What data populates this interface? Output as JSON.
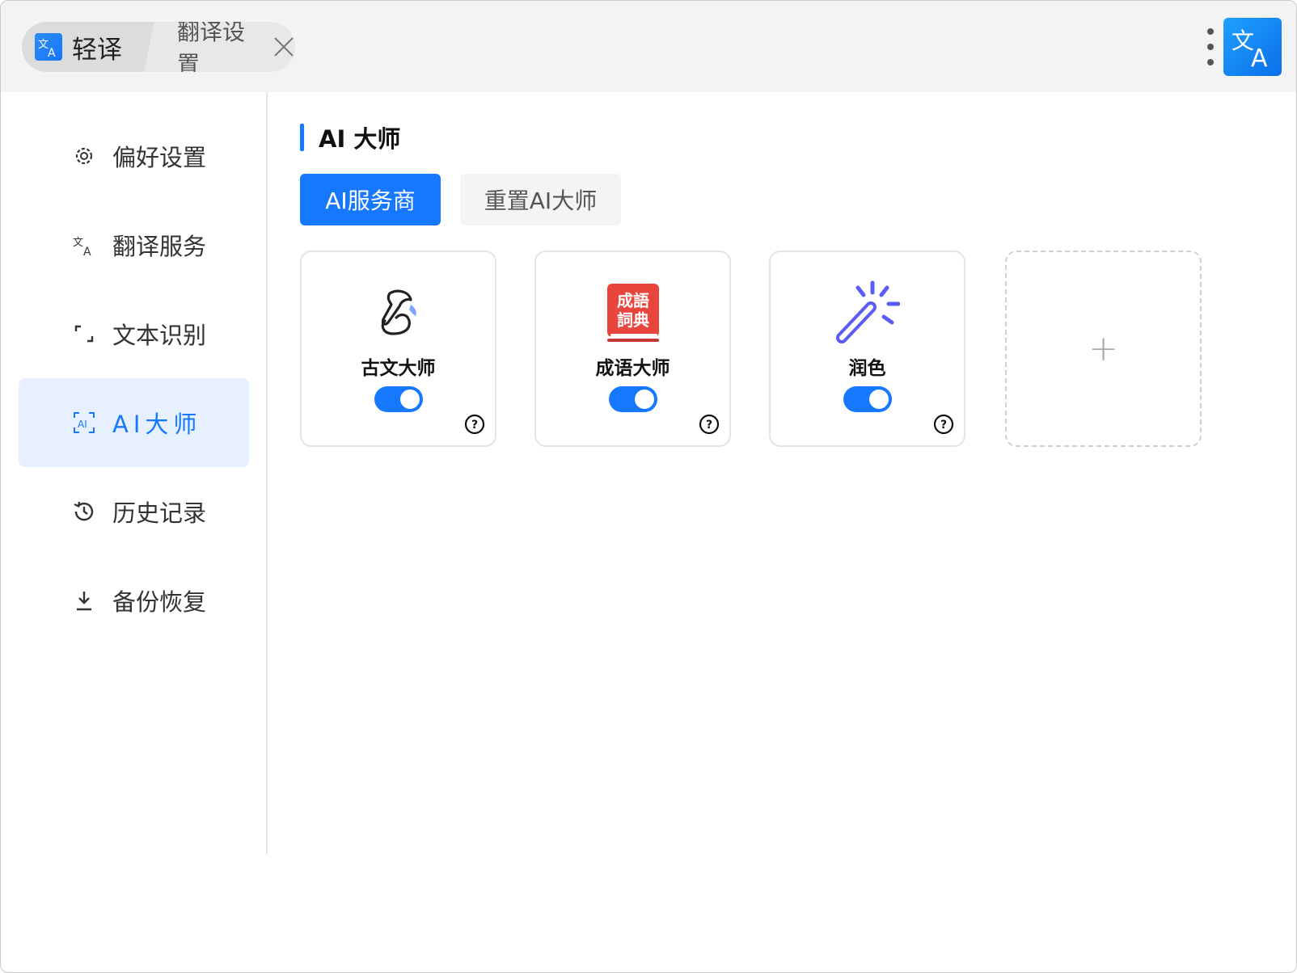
{
  "titlebar": {
    "tabs": [
      {
        "label": "轻译",
        "icon": "translate-icon"
      },
      {
        "label": "翻译设置",
        "close_icon": "close-icon"
      }
    ],
    "more_icon": "more-vertical-icon",
    "app_icon": "translate-app-icon"
  },
  "sidebar": {
    "items": [
      {
        "label": "偏好设置",
        "icon": "gear-icon"
      },
      {
        "label": "翻译服务",
        "icon": "translate-icon"
      },
      {
        "label": "文本识别",
        "icon": "scan-frame-icon"
      },
      {
        "label": "AI大师",
        "icon": "ai-frame-icon",
        "active": true
      },
      {
        "label": "历史记录",
        "icon": "history-icon"
      },
      {
        "label": "备份恢复",
        "icon": "download-icon"
      }
    ]
  },
  "main": {
    "section_title": "AI 大师",
    "buttons": {
      "primary": "AI服务商",
      "secondary": "重置AI大师"
    },
    "cards": [
      {
        "label": "古文大师",
        "icon": "ink-brush-icon",
        "enabled": true
      },
      {
        "label": "成语大师",
        "icon": "idiom-dictionary-icon",
        "icon_text": [
          "成語",
          "詞典"
        ],
        "enabled": true
      },
      {
        "label": "润色",
        "icon": "magic-wand-icon",
        "enabled": true
      }
    ],
    "add_card": {
      "label": "+"
    }
  },
  "colors": {
    "accent": "#1677ff",
    "active_bg": "#e6f0fe",
    "dictionary_red": "#e8453c",
    "wand_purple": "#5b5bf5"
  }
}
